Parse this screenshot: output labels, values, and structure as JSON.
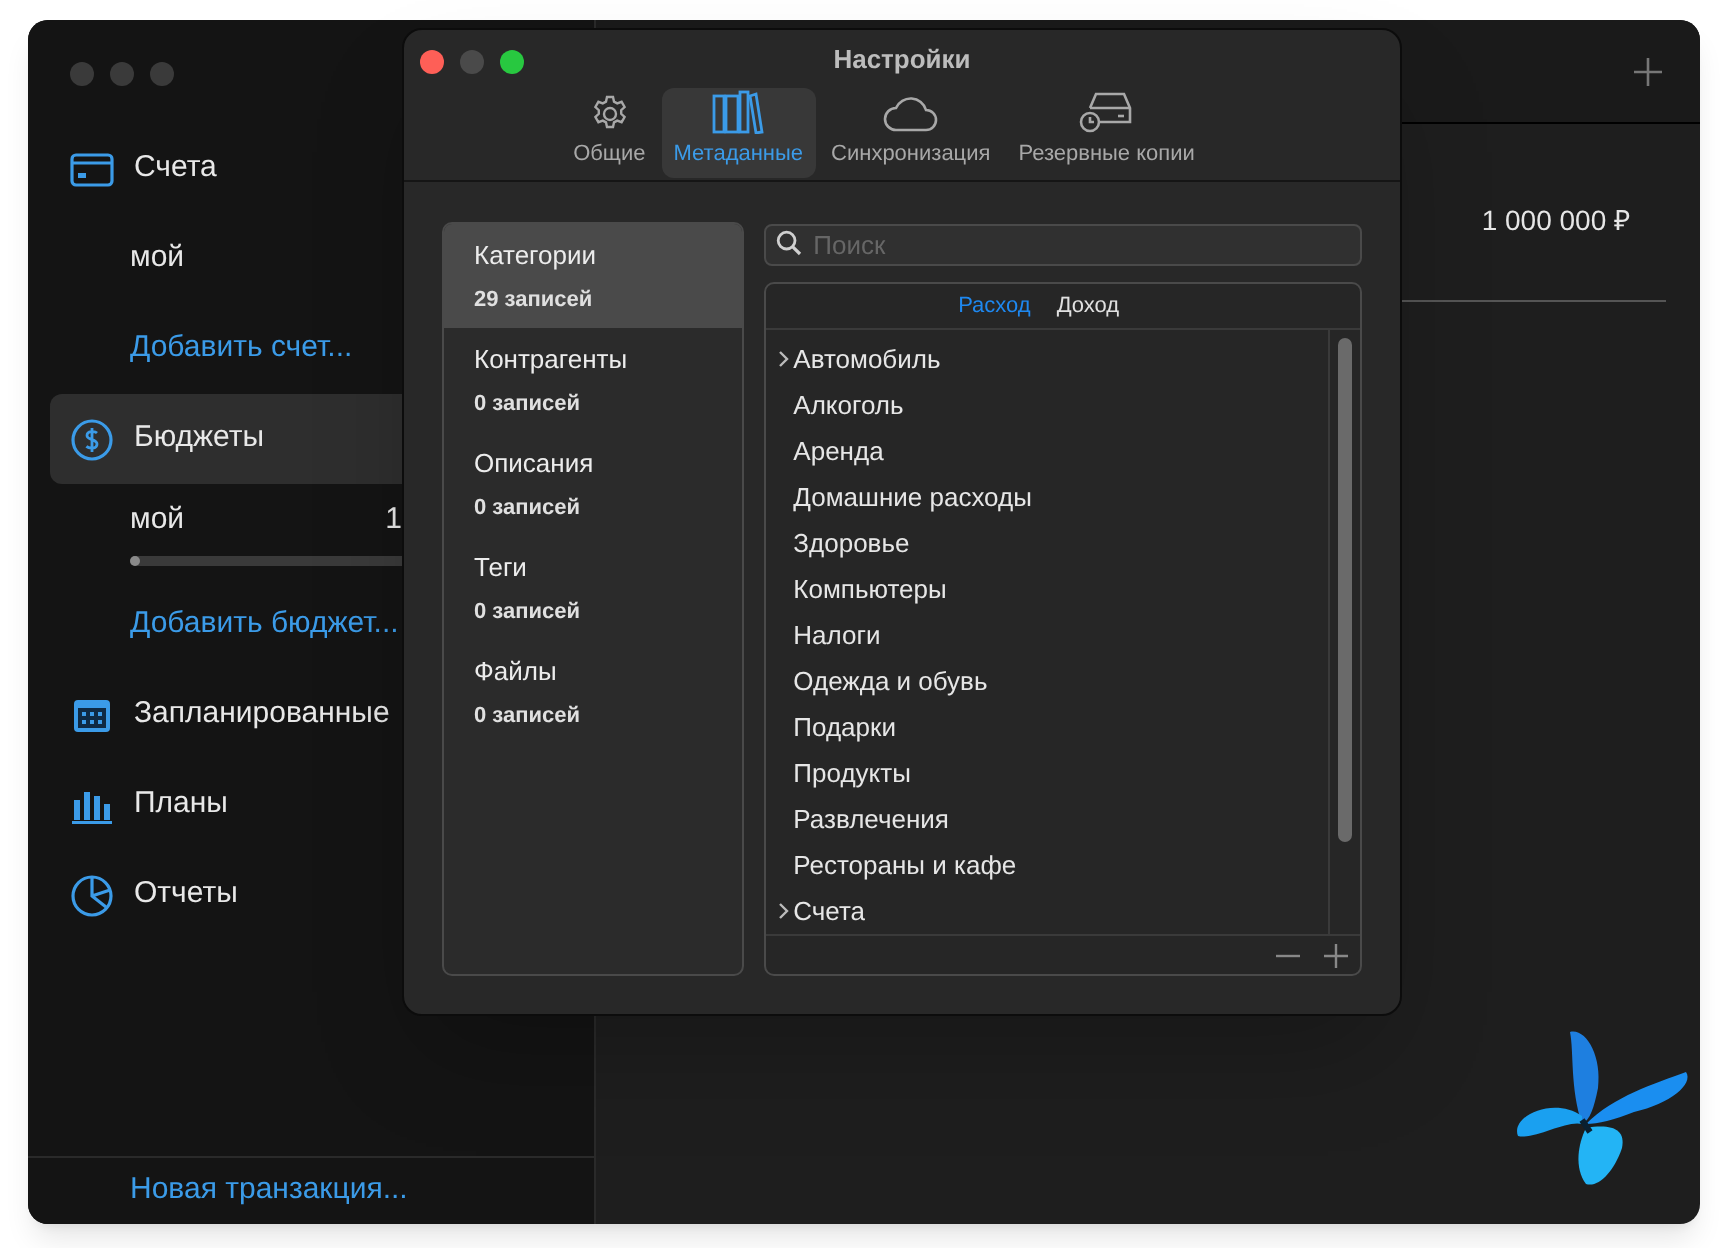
{
  "sidebar": {
    "items": [
      {
        "kind": "nav",
        "label": "Счета",
        "selected": false
      },
      {
        "kind": "account",
        "label": "мой"
      },
      {
        "kind": "link",
        "label": "Добавить счет..."
      },
      {
        "kind": "nav",
        "label": "Бюджеты",
        "selected": true
      },
      {
        "kind": "budget",
        "label": "мой",
        "amount": "1",
        "level": 0
      },
      {
        "kind": "link",
        "label": "Добавить бюджет..."
      },
      {
        "kind": "nav",
        "label": "Запланированные",
        "selected": false
      },
      {
        "kind": "nav",
        "label": "Планы",
        "selected": false
      },
      {
        "kind": "nav",
        "label": "Отчеты",
        "selected": false
      }
    ],
    "footer_link": "Новая транзакция..."
  },
  "content": {
    "amount": "1 000 000 ₽"
  },
  "dialog": {
    "title": "Настройки",
    "tabs": [
      {
        "label": "Общие",
        "selected": false
      },
      {
        "label": "Метаданные",
        "selected": true
      },
      {
        "label": "Синхронизация",
        "selected": false
      },
      {
        "label": "Резервные копии",
        "selected": false
      }
    ],
    "sections": [
      {
        "label": "Категории",
        "count": "29 записей",
        "selected": true
      },
      {
        "label": "Контрагенты",
        "count": "0 записей",
        "selected": false
      },
      {
        "label": "Описания",
        "count": "0 записей",
        "selected": false
      },
      {
        "label": "Теги",
        "count": "0 записей",
        "selected": false
      },
      {
        "label": "Файлы",
        "count": "0 записей",
        "selected": false
      }
    ],
    "search": {
      "placeholder": "Поиск"
    },
    "segments": [
      {
        "label": "Расход",
        "selected": true
      },
      {
        "label": "Доход",
        "selected": false
      }
    ],
    "categories": [
      {
        "label": "Автомобиль",
        "expandable": true
      },
      {
        "label": "Алкоголь",
        "expandable": false
      },
      {
        "label": "Аренда",
        "expandable": false
      },
      {
        "label": "Домашние расходы",
        "expandable": false
      },
      {
        "label": "Здоровье",
        "expandable": false
      },
      {
        "label": "Компьютеры",
        "expandable": false
      },
      {
        "label": "Налоги",
        "expandable": false
      },
      {
        "label": "Одежда и обувь",
        "expandable": false
      },
      {
        "label": "Подарки",
        "expandable": false
      },
      {
        "label": "Продукты",
        "expandable": false
      },
      {
        "label": "Развлечения",
        "expandable": false
      },
      {
        "label": "Рестораны и кафе",
        "expandable": false
      },
      {
        "label": "Счета",
        "expandable": true
      }
    ]
  }
}
